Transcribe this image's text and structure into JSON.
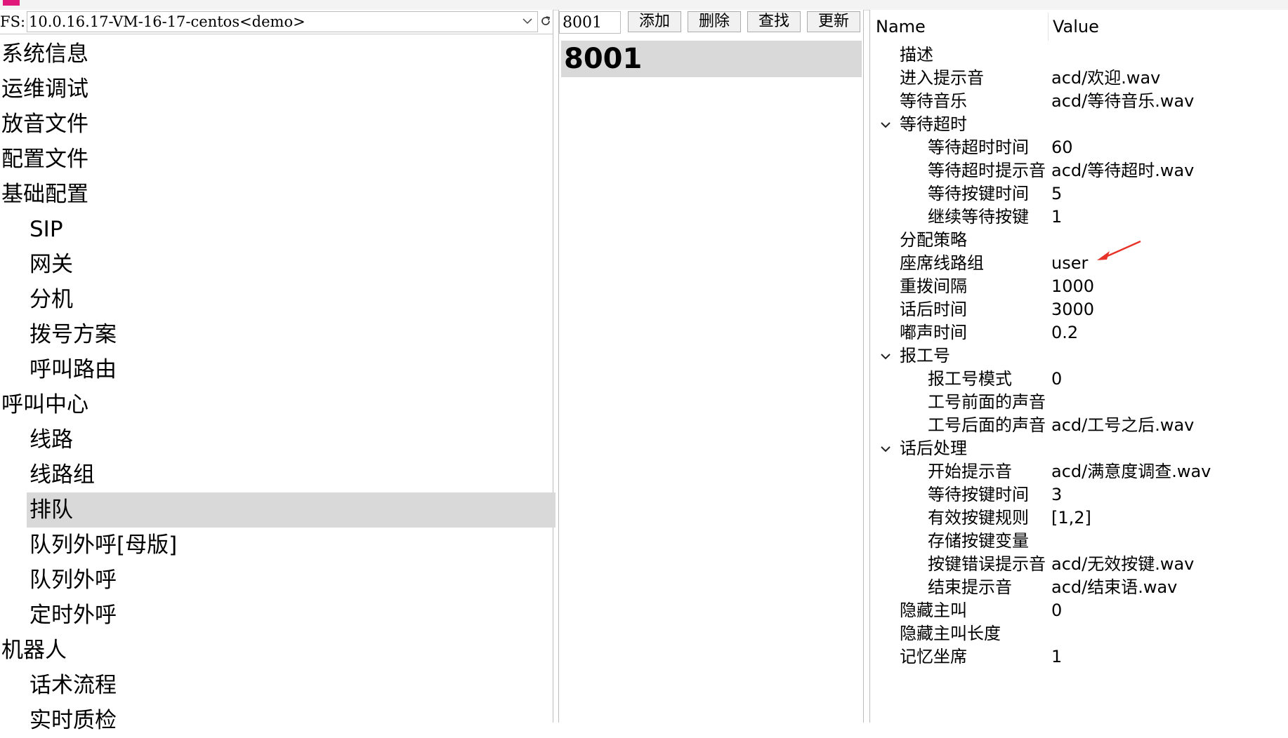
{
  "server": {
    "label": "FS:",
    "value": "10.0.16.17-VM-16-17-centos<demo>"
  },
  "nav": [
    {
      "label": "系统信息",
      "level": 0
    },
    {
      "label": "运维调试",
      "level": 0
    },
    {
      "label": "放音文件",
      "level": 0
    },
    {
      "label": "配置文件",
      "level": 0
    },
    {
      "label": "基础配置",
      "level": 0
    },
    {
      "label": "SIP",
      "level": 1
    },
    {
      "label": "网关",
      "level": 1
    },
    {
      "label": "分机",
      "level": 1
    },
    {
      "label": "拨号方案",
      "level": 1
    },
    {
      "label": "呼叫路由",
      "level": 1
    },
    {
      "label": "呼叫中心",
      "level": 0
    },
    {
      "label": "线路",
      "level": 1
    },
    {
      "label": "线路组",
      "level": 1
    },
    {
      "label": "排队",
      "level": 1,
      "selected": true
    },
    {
      "label": "队列外呼[母版]",
      "level": 1
    },
    {
      "label": "队列外呼",
      "level": 1
    },
    {
      "label": "定时外呼",
      "level": 1
    },
    {
      "label": "机器人",
      "level": 0
    },
    {
      "label": "话术流程",
      "level": 1
    },
    {
      "label": "实时质检",
      "level": 1
    }
  ],
  "toolbar": {
    "search_value": "8001",
    "add_label": "添加",
    "delete_label": "删除",
    "find_label": "查找",
    "update_label": "更新"
  },
  "queue_list": [
    {
      "label": "8001",
      "selected": true
    }
  ],
  "properties": {
    "name_header": "Name",
    "value_header": "Value",
    "rows": [
      {
        "name": "描述",
        "value": "",
        "level": 0
      },
      {
        "name": "进入提示音",
        "value": "acd/欢迎.wav",
        "level": 0
      },
      {
        "name": "等待音乐",
        "value": "acd/等待音乐.wav",
        "level": 0
      },
      {
        "name": "等待超时",
        "value": "",
        "level": 0,
        "expanded": true
      },
      {
        "name": "等待超时时间",
        "value": "60",
        "level": 1
      },
      {
        "name": "等待超时提示音",
        "value": "acd/等待超时.wav",
        "level": 1
      },
      {
        "name": "等待按键时间",
        "value": "5",
        "level": 1
      },
      {
        "name": "继续等待按键",
        "value": "1",
        "level": 1
      },
      {
        "name": "分配策略",
        "value": "",
        "level": 0
      },
      {
        "name": "座席线路组",
        "value": "user",
        "level": 0
      },
      {
        "name": "重拨间隔",
        "value": "1000",
        "level": 0
      },
      {
        "name": "话后时间",
        "value": "3000",
        "level": 0
      },
      {
        "name": "嘟声时间",
        "value": "0.2",
        "level": 0
      },
      {
        "name": "报工号",
        "value": "",
        "level": 0,
        "expanded": true
      },
      {
        "name": "报工号模式",
        "value": "0",
        "level": 1
      },
      {
        "name": "工号前面的声音",
        "value": "",
        "level": 1
      },
      {
        "name": "工号后面的声音",
        "value": "acd/工号之后.wav",
        "level": 1
      },
      {
        "name": "话后处理",
        "value": "",
        "level": 0,
        "expanded": true
      },
      {
        "name": "开始提示音",
        "value": "acd/满意度调查.wav",
        "level": 1
      },
      {
        "name": "等待按键时间",
        "value": "3",
        "level": 1
      },
      {
        "name": "有效按键规则",
        "value": "[1,2]",
        "level": 1
      },
      {
        "name": "存储按键变量",
        "value": "",
        "level": 1
      },
      {
        "name": "按键错误提示音",
        "value": "acd/无效按键.wav",
        "level": 1
      },
      {
        "name": "结束提示音",
        "value": "acd/结束语.wav",
        "level": 1
      },
      {
        "name": "隐藏主叫",
        "value": "0",
        "level": 0
      },
      {
        "name": "隐藏主叫长度",
        "value": "",
        "level": 0
      },
      {
        "name": "记忆坐席",
        "value": "1",
        "level": 0
      }
    ]
  },
  "colors": {
    "selection": "#d9d9d9",
    "annotation_arrow": "#e8332a",
    "logo": "#e0187a"
  }
}
